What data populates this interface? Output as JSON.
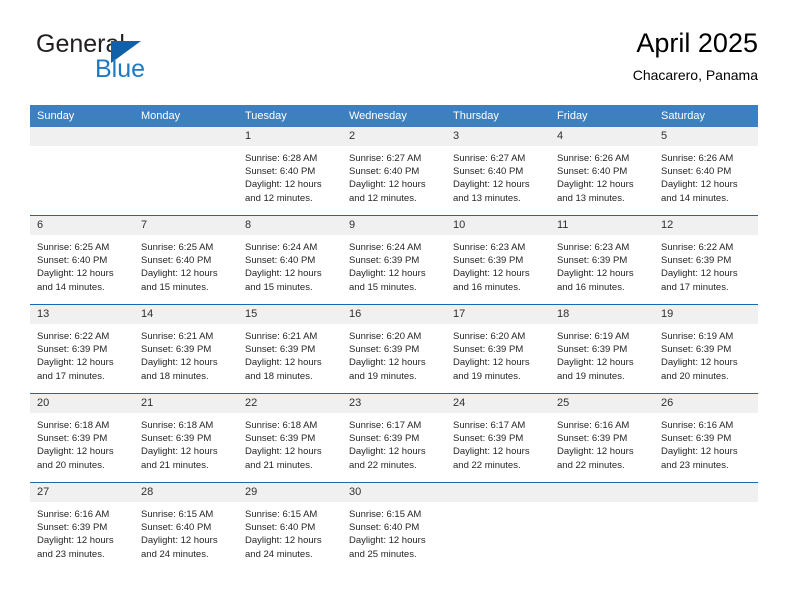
{
  "brand": {
    "word1": "General",
    "word2": "Blue",
    "triangle_color": "#1260a8",
    "blue_color": "#1f7ac0"
  },
  "header": {
    "title": "April 2025",
    "subtitle": "Chacarero, Panama"
  },
  "theme": {
    "header_blue": "#3d7fbf",
    "row_divider_blue": "#1b69ad",
    "daynum_band": "#f0f0f0"
  },
  "weekdays": [
    "Sunday",
    "Monday",
    "Tuesday",
    "Wednesday",
    "Thursday",
    "Friday",
    "Saturday"
  ],
  "weeks": [
    [
      {
        "day": "",
        "sunrise": "",
        "sunset": "",
        "daylight_1": "",
        "daylight_2": ""
      },
      {
        "day": "",
        "sunrise": "",
        "sunset": "",
        "daylight_1": "",
        "daylight_2": ""
      },
      {
        "day": "1",
        "sunrise": "Sunrise: 6:28 AM",
        "sunset": "Sunset: 6:40 PM",
        "daylight_1": "Daylight: 12 hours",
        "daylight_2": "and 12 minutes."
      },
      {
        "day": "2",
        "sunrise": "Sunrise: 6:27 AM",
        "sunset": "Sunset: 6:40 PM",
        "daylight_1": "Daylight: 12 hours",
        "daylight_2": "and 12 minutes."
      },
      {
        "day": "3",
        "sunrise": "Sunrise: 6:27 AM",
        "sunset": "Sunset: 6:40 PM",
        "daylight_1": "Daylight: 12 hours",
        "daylight_2": "and 13 minutes."
      },
      {
        "day": "4",
        "sunrise": "Sunrise: 6:26 AM",
        "sunset": "Sunset: 6:40 PM",
        "daylight_1": "Daylight: 12 hours",
        "daylight_2": "and 13 minutes."
      },
      {
        "day": "5",
        "sunrise": "Sunrise: 6:26 AM",
        "sunset": "Sunset: 6:40 PM",
        "daylight_1": "Daylight: 12 hours",
        "daylight_2": "and 14 minutes."
      }
    ],
    [
      {
        "day": "6",
        "sunrise": "Sunrise: 6:25 AM",
        "sunset": "Sunset: 6:40 PM",
        "daylight_1": "Daylight: 12 hours",
        "daylight_2": "and 14 minutes."
      },
      {
        "day": "7",
        "sunrise": "Sunrise: 6:25 AM",
        "sunset": "Sunset: 6:40 PM",
        "daylight_1": "Daylight: 12 hours",
        "daylight_2": "and 15 minutes."
      },
      {
        "day": "8",
        "sunrise": "Sunrise: 6:24 AM",
        "sunset": "Sunset: 6:40 PM",
        "daylight_1": "Daylight: 12 hours",
        "daylight_2": "and 15 minutes."
      },
      {
        "day": "9",
        "sunrise": "Sunrise: 6:24 AM",
        "sunset": "Sunset: 6:39 PM",
        "daylight_1": "Daylight: 12 hours",
        "daylight_2": "and 15 minutes."
      },
      {
        "day": "10",
        "sunrise": "Sunrise: 6:23 AM",
        "sunset": "Sunset: 6:39 PM",
        "daylight_1": "Daylight: 12 hours",
        "daylight_2": "and 16 minutes."
      },
      {
        "day": "11",
        "sunrise": "Sunrise: 6:23 AM",
        "sunset": "Sunset: 6:39 PM",
        "daylight_1": "Daylight: 12 hours",
        "daylight_2": "and 16 minutes."
      },
      {
        "day": "12",
        "sunrise": "Sunrise: 6:22 AM",
        "sunset": "Sunset: 6:39 PM",
        "daylight_1": "Daylight: 12 hours",
        "daylight_2": "and 17 minutes."
      }
    ],
    [
      {
        "day": "13",
        "sunrise": "Sunrise: 6:22 AM",
        "sunset": "Sunset: 6:39 PM",
        "daylight_1": "Daylight: 12 hours",
        "daylight_2": "and 17 minutes."
      },
      {
        "day": "14",
        "sunrise": "Sunrise: 6:21 AM",
        "sunset": "Sunset: 6:39 PM",
        "daylight_1": "Daylight: 12 hours",
        "daylight_2": "and 18 minutes."
      },
      {
        "day": "15",
        "sunrise": "Sunrise: 6:21 AM",
        "sunset": "Sunset: 6:39 PM",
        "daylight_1": "Daylight: 12 hours",
        "daylight_2": "and 18 minutes."
      },
      {
        "day": "16",
        "sunrise": "Sunrise: 6:20 AM",
        "sunset": "Sunset: 6:39 PM",
        "daylight_1": "Daylight: 12 hours",
        "daylight_2": "and 19 minutes."
      },
      {
        "day": "17",
        "sunrise": "Sunrise: 6:20 AM",
        "sunset": "Sunset: 6:39 PM",
        "daylight_1": "Daylight: 12 hours",
        "daylight_2": "and 19 minutes."
      },
      {
        "day": "18",
        "sunrise": "Sunrise: 6:19 AM",
        "sunset": "Sunset: 6:39 PM",
        "daylight_1": "Daylight: 12 hours",
        "daylight_2": "and 19 minutes."
      },
      {
        "day": "19",
        "sunrise": "Sunrise: 6:19 AM",
        "sunset": "Sunset: 6:39 PM",
        "daylight_1": "Daylight: 12 hours",
        "daylight_2": "and 20 minutes."
      }
    ],
    [
      {
        "day": "20",
        "sunrise": "Sunrise: 6:18 AM",
        "sunset": "Sunset: 6:39 PM",
        "daylight_1": "Daylight: 12 hours",
        "daylight_2": "and 20 minutes."
      },
      {
        "day": "21",
        "sunrise": "Sunrise: 6:18 AM",
        "sunset": "Sunset: 6:39 PM",
        "daylight_1": "Daylight: 12 hours",
        "daylight_2": "and 21 minutes."
      },
      {
        "day": "22",
        "sunrise": "Sunrise: 6:18 AM",
        "sunset": "Sunset: 6:39 PM",
        "daylight_1": "Daylight: 12 hours",
        "daylight_2": "and 21 minutes."
      },
      {
        "day": "23",
        "sunrise": "Sunrise: 6:17 AM",
        "sunset": "Sunset: 6:39 PM",
        "daylight_1": "Daylight: 12 hours",
        "daylight_2": "and 22 minutes."
      },
      {
        "day": "24",
        "sunrise": "Sunrise: 6:17 AM",
        "sunset": "Sunset: 6:39 PM",
        "daylight_1": "Daylight: 12 hours",
        "daylight_2": "and 22 minutes."
      },
      {
        "day": "25",
        "sunrise": "Sunrise: 6:16 AM",
        "sunset": "Sunset: 6:39 PM",
        "daylight_1": "Daylight: 12 hours",
        "daylight_2": "and 22 minutes."
      },
      {
        "day": "26",
        "sunrise": "Sunrise: 6:16 AM",
        "sunset": "Sunset: 6:39 PM",
        "daylight_1": "Daylight: 12 hours",
        "daylight_2": "and 23 minutes."
      }
    ],
    [
      {
        "day": "27",
        "sunrise": "Sunrise: 6:16 AM",
        "sunset": "Sunset: 6:39 PM",
        "daylight_1": "Daylight: 12 hours",
        "daylight_2": "and 23 minutes."
      },
      {
        "day": "28",
        "sunrise": "Sunrise: 6:15 AM",
        "sunset": "Sunset: 6:40 PM",
        "daylight_1": "Daylight: 12 hours",
        "daylight_2": "and 24 minutes."
      },
      {
        "day": "29",
        "sunrise": "Sunrise: 6:15 AM",
        "sunset": "Sunset: 6:40 PM",
        "daylight_1": "Daylight: 12 hours",
        "daylight_2": "and 24 minutes."
      },
      {
        "day": "30",
        "sunrise": "Sunrise: 6:15 AM",
        "sunset": "Sunset: 6:40 PM",
        "daylight_1": "Daylight: 12 hours",
        "daylight_2": "and 25 minutes."
      },
      {
        "day": "",
        "sunrise": "",
        "sunset": "",
        "daylight_1": "",
        "daylight_2": ""
      },
      {
        "day": "",
        "sunrise": "",
        "sunset": "",
        "daylight_1": "",
        "daylight_2": ""
      },
      {
        "day": "",
        "sunrise": "",
        "sunset": "",
        "daylight_1": "",
        "daylight_2": ""
      }
    ]
  ]
}
